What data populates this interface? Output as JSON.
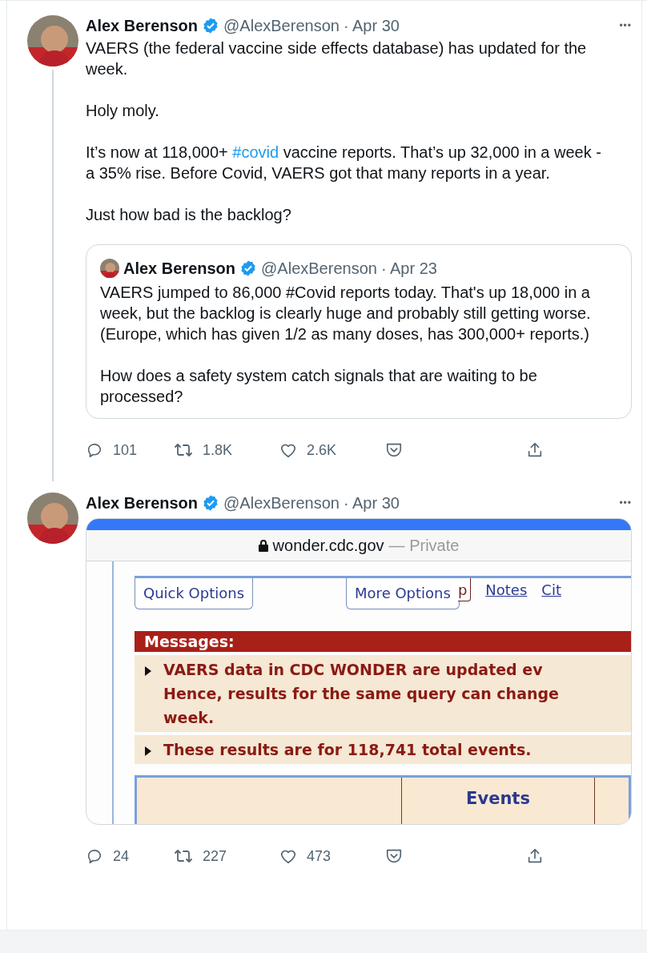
{
  "tweets": [
    {
      "author": "Alex Berenson",
      "verified": true,
      "handle": "@AlexBerenson",
      "date": "· Apr 30",
      "more": "•••",
      "thread": true,
      "paragraphs": [
        [
          {
            "text": "VAERS (the federal vaccine side effects database) has updated for the week."
          }
        ],
        [
          {
            "text": "Holy moly."
          }
        ],
        [
          {
            "text": "It’s now at 118,000+ "
          },
          {
            "text": "#covid",
            "kind": "hashtag"
          },
          {
            "text": " vaccine reports. That’s up 32,000 in a week - a 35% rise. Before Covid, VAERS got that many reports in a year."
          }
        ],
        [
          {
            "text": "Just how bad is the backlog?"
          }
        ]
      ],
      "quote": {
        "author": "Alex Berenson",
        "verified": true,
        "handle": "@AlexBerenson",
        "date": "· Apr 23",
        "paragraphs": [
          "VAERS jumped to 86,000 #Covid reports today. That's up 18,000 in a week, but the backlog is clearly huge and probably still getting worse. (Europe, which has given 1/2 as many doses, has 300,000+ reports.)",
          "How does a safety system catch signals that are waiting to be processed?"
        ]
      },
      "actions": {
        "replies": "101",
        "retweets": "1.8K",
        "likes": "2.6K"
      }
    },
    {
      "author": "Alex Berenson",
      "verified": true,
      "handle": "@AlexBerenson",
      "date": "· Apr 30",
      "more": "•••",
      "thread": false,
      "media": {
        "kind": "screenshot",
        "url": "wonder.cdc.gov",
        "privacy": "— Private",
        "buttons": [
          "Quick Options",
          "More Options"
        ],
        "hidden_button": "p",
        "links": [
          "Notes",
          "Cit"
        ],
        "messages_title": "Messages:",
        "messages": [
          "VAERS data in CDC WONDER are updated ev\nHence, results for the same query can change\nweek.",
          "These results are for 118,741 total events."
        ],
        "table_header": "Events"
      },
      "actions": {
        "replies": "24",
        "retweets": "227",
        "likes": "473"
      }
    }
  ]
}
